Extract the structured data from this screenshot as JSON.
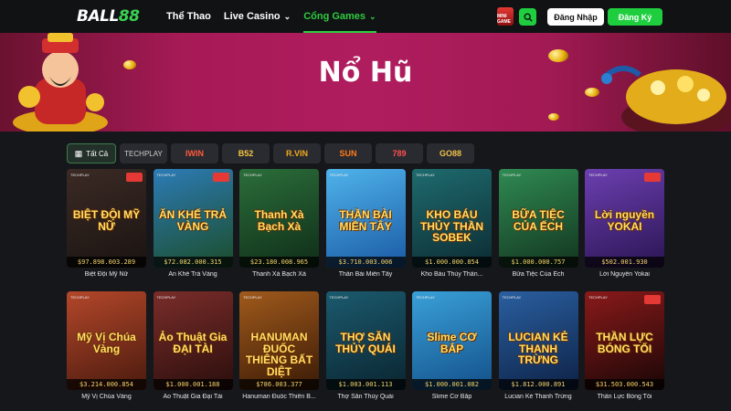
{
  "header": {
    "logo_main": "BALL",
    "logo_num": "88",
    "nav": [
      {
        "label": "Thể Thao",
        "has_chevron": false
      },
      {
        "label": "Live Casino",
        "has_chevron": true
      },
      {
        "label": "Cổng Games",
        "has_chevron": true,
        "active": true
      }
    ],
    "mini_game_label": "MINI GAME",
    "login_label": "Đăng Nhập",
    "register_label": "Đăng Ký"
  },
  "banner": {
    "title": "Nổ Hũ"
  },
  "filters": {
    "all_label": "Tất Cả",
    "providers": [
      "TECHPLAY",
      "IWIN",
      "B52",
      "R.VIN",
      "SUN",
      "789",
      "GO88"
    ]
  },
  "colors": {
    "accent": "#1fce3f",
    "banner": "#b01d5f",
    "jackpot_text": "#f3d36b"
  },
  "games": [
    {
      "name": "Biệt Đội Mỹ Nữ",
      "jackpot": "$97.898.003.289",
      "art": "BIỆT ĐỘI MỸ NỮ",
      "bg": [
        "#3b2a24",
        "#1a1412"
      ],
      "badge": true
    },
    {
      "name": "Ăn Khế Trả Vàng",
      "jackpot": "$72.082.000.315",
      "art": "ĂN KHẾ TRẢ VÀNG",
      "bg": [
        "#2c7bb6",
        "#1b4d2a"
      ],
      "badge": true
    },
    {
      "name": "Thanh Xà Bạch Xà",
      "jackpot": "$23.180.008.965",
      "art": "Thanh Xà Bạch Xà",
      "bg": [
        "#2b6e3a",
        "#0f2d18"
      ],
      "badge": false
    },
    {
      "name": "Thần Bài Miền Tây",
      "jackpot": "$3.710.003.006",
      "art": "THẦN BÀI MIỀN TÂY",
      "bg": [
        "#4fb3ea",
        "#1a5aa5"
      ],
      "badge": false
    },
    {
      "name": "Kho Báu Thủy Thần...",
      "jackpot": "$1.000.000.854",
      "art": "KHO BÁU THỦY THẦN SOBEK",
      "bg": [
        "#1e6b6e",
        "#0c2c33"
      ],
      "badge": false
    },
    {
      "name": "Bữa Tiệc Của Ếch",
      "jackpot": "$1.000.000.757",
      "art": "BỮA TIỆC CỦA ẾCH",
      "bg": [
        "#2f8a52",
        "#13351f"
      ],
      "badge": false
    },
    {
      "name": "Lời Nguyền Yokai",
      "jackpot": "$502.001.930",
      "art": "Lời nguyền YOKAI",
      "bg": [
        "#6c3fb0",
        "#2a1553"
      ],
      "badge": true
    },
    {
      "name": "Mỹ Vị Chúa Vàng",
      "jackpot": "$3.214.000.854",
      "art": "Mỹ Vị Chúa Vàng",
      "bg": [
        "#b3472a",
        "#4a1a0e"
      ],
      "badge": false
    },
    {
      "name": "Ảo Thuật Gia Đại Tài",
      "jackpot": "$1.000.001.188",
      "art": "Ảo Thuật Gia ĐẠI TÀI",
      "bg": [
        "#7a2d2a",
        "#2a0e0c"
      ],
      "badge": false
    },
    {
      "name": "Hanuman Đuốc Thiên B...",
      "jackpot": "$786.003.377",
      "art": "HANUMAN ĐUỐC THIÊNG BẤT DIỆT",
      "bg": [
        "#a05a1c",
        "#3a1a06"
      ],
      "badge": false
    },
    {
      "name": "Thợ Săn Thủy Quái",
      "jackpot": "$1.003.001.113",
      "art": "THỢ SĂN THỦY QUÁI",
      "bg": [
        "#1b5a6e",
        "#0a2530"
      ],
      "badge": false
    },
    {
      "name": "Slime Cơ Bắp",
      "jackpot": "$1.000.001.082",
      "art": "Slime CƠ BẮP",
      "bg": [
        "#3aa0d8",
        "#13508a"
      ],
      "badge": false
    },
    {
      "name": "Lucian Kẻ Thanh Trừng",
      "jackpot": "$1.812.000.891",
      "art": "LUCIAN KẺ THANH TRỪNG",
      "bg": [
        "#2a5fa0",
        "#0d2246"
      ],
      "badge": false
    },
    {
      "name": "Thần Lực Bóng Tối",
      "jackpot": "$31.503.000.543",
      "art": "THẦN LỰC BÓNG TỐI",
      "bg": [
        "#8a1a1a",
        "#1a0606"
      ],
      "badge": true
    }
  ]
}
